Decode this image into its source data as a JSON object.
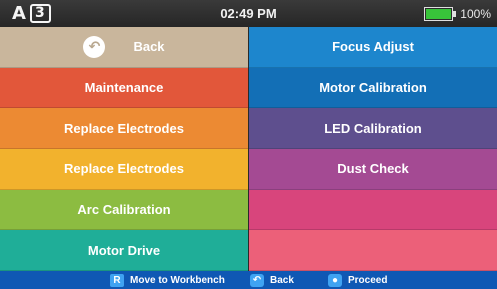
{
  "status": {
    "logo_letter": "A",
    "logo_boxed": "3",
    "time": "02:49 PM",
    "battery_percent": "100%",
    "battery_level": 1.0
  },
  "menu": {
    "left": [
      {
        "label": "Back",
        "color": "#c9b69c",
        "icon": "back-arrow-icon"
      },
      {
        "label": "Maintenance",
        "color": "#e2573a"
      },
      {
        "label": "Replace Electrodes",
        "color": "#ec8a33"
      },
      {
        "label": "Replace Electrodes",
        "color": "#f2b22d"
      },
      {
        "label": "Arc Calibration",
        "color": "#8cbc41"
      },
      {
        "label": "Motor Drive",
        "color": "#1fae98"
      }
    ],
    "right": [
      {
        "label": "Focus Adjust",
        "color": "#1d86cd"
      },
      {
        "label": "Motor Calibration",
        "color": "#136fb6"
      },
      {
        "label": "LED Calibration",
        "color": "#5e4f8e"
      },
      {
        "label": "Dust Check",
        "color": "#a44a93"
      },
      {
        "label": "",
        "color": "#d8457c"
      },
      {
        "label": "",
        "color": "#ec6079"
      }
    ]
  },
  "bottom": {
    "hint1_key": "R",
    "hint1_label": "Move to Workbench",
    "hint2_key": "back-arrow-icon",
    "hint2_label": "Back",
    "hint3_key": "ok-circle-icon",
    "hint3_label": "Proceed"
  }
}
